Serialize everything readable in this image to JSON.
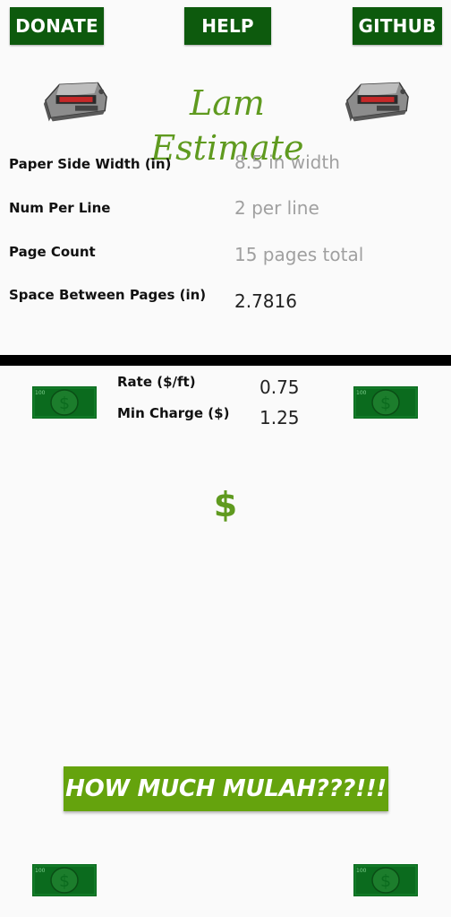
{
  "header": {
    "donate_label": "DONATE",
    "help_label": "HELP",
    "github_label": "GITHUB"
  },
  "brand": {
    "title": "Lam Estimate",
    "image_left": "laminator-icon",
    "image_right": "laminator-icon"
  },
  "form": {
    "paper_width": {
      "label": "Paper Side Width (in)",
      "value": "",
      "placeholder": "8.5 in width"
    },
    "num_per_line": {
      "label": "Num Per Line",
      "value": "",
      "placeholder": "2 per line"
    },
    "page_count": {
      "label": "Page Count",
      "value": "",
      "placeholder": "15 pages total"
    },
    "space_between": {
      "label": "Space Between Pages (in)",
      "value": "2.7816",
      "placeholder": ""
    }
  },
  "pricing": {
    "rate": {
      "label": "Rate ($/ft)",
      "value": "0.75"
    },
    "min_charge": {
      "label": "Min Charge ($)",
      "value": "1.25"
    }
  },
  "result": {
    "text": "$"
  },
  "calculate_label": "HOW MUCH MULAH???!!!",
  "decor": {
    "bill_icon": "dollar-bill-icon",
    "bill_denomination": "100",
    "bill_symbol": "$"
  },
  "colors": {
    "header_button_bg": "#0d5a0d",
    "accent_green": "#5f9a1f",
    "calc_button_bg": "#65a30d",
    "divider": "#000000"
  }
}
